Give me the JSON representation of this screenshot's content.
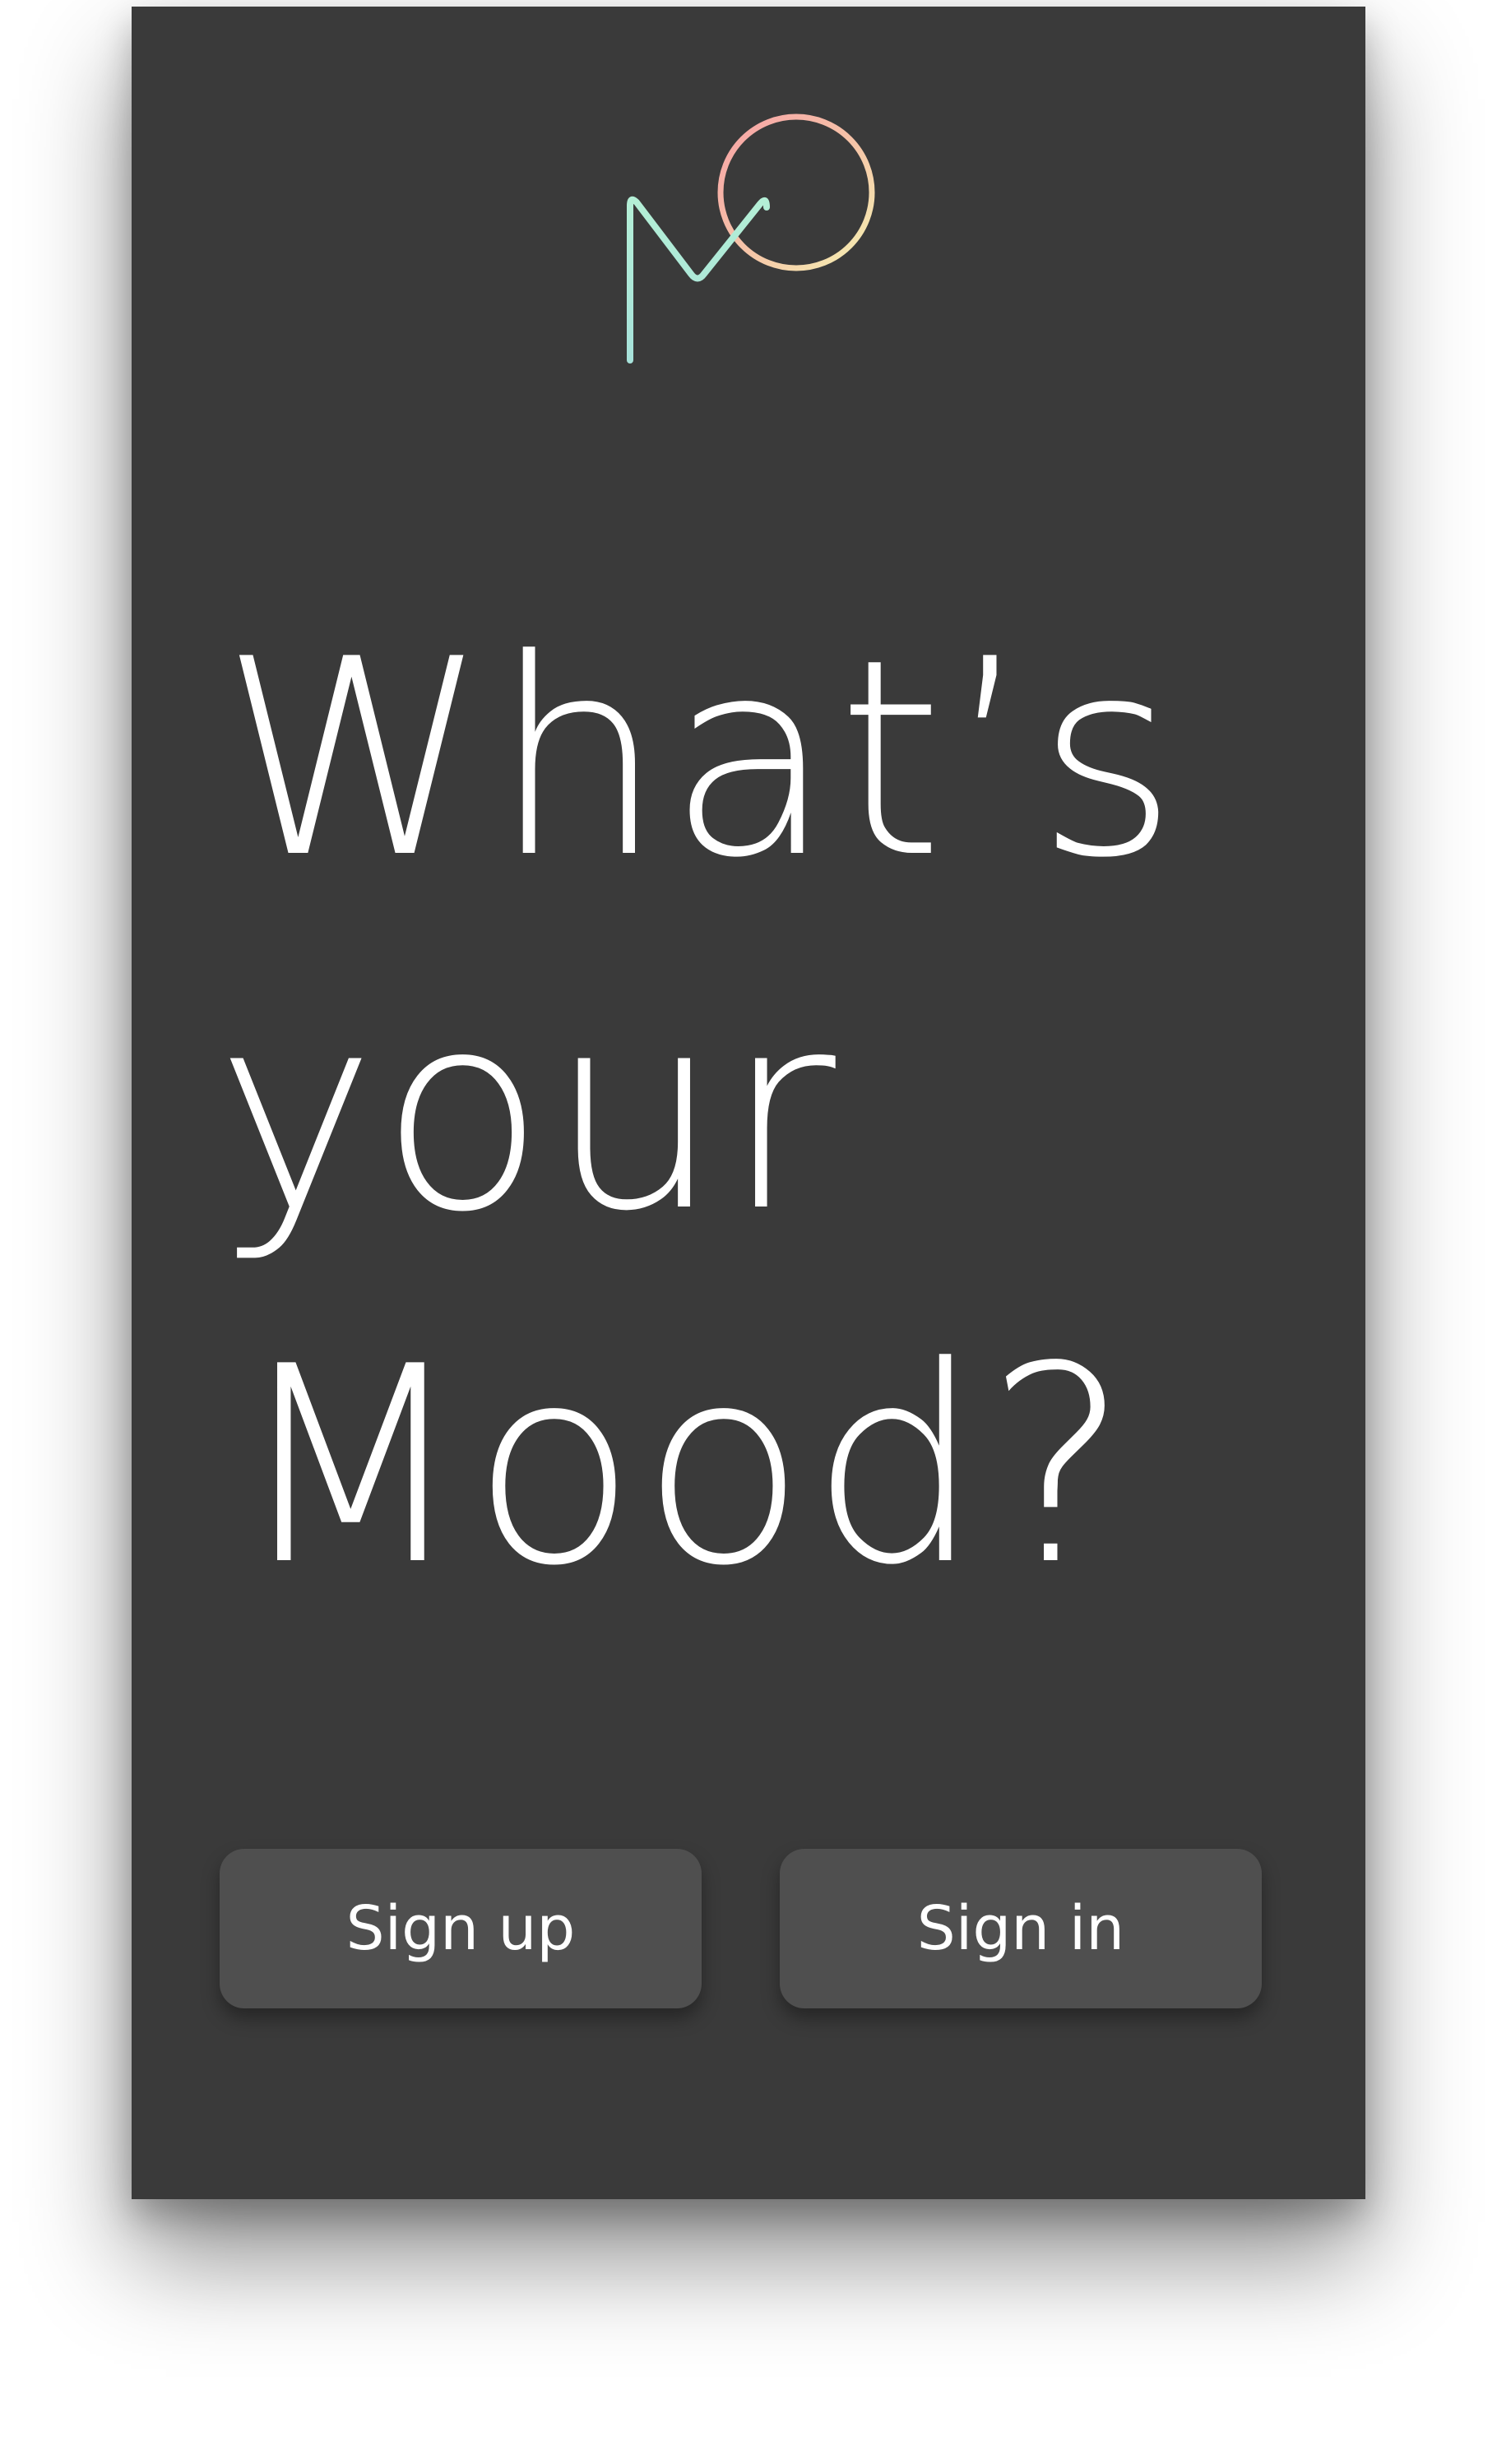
{
  "app": {
    "logo_icon": "mood-monogram-icon"
  },
  "colors": {
    "background": "#3a3a3a",
    "button": "#4f4f4f",
    "text": "#ffffff",
    "logo_teal": "#a8e8d6",
    "logo_pink": "#f6a9a9",
    "logo_yellow": "#f4f0b0",
    "logo_lavender": "#b5b3f0"
  },
  "headline": {
    "line1": "What’s",
    "line2": "your",
    "line3": "Mood?"
  },
  "actions": {
    "sign_up_label": "Sign up",
    "sign_in_label": "Sign in"
  }
}
